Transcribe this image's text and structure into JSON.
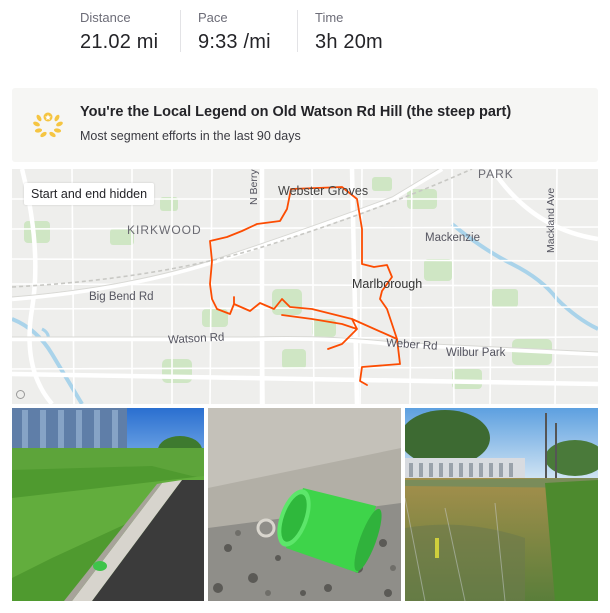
{
  "stats": [
    {
      "label": "Distance",
      "value": "21.02 mi"
    },
    {
      "label": "Pace",
      "value": "9:33 /mi"
    },
    {
      "label": "Time",
      "value": "3h 20m"
    }
  ],
  "legend": {
    "title": "You're the Local Legend on Old Watson Rd Hill (the steep part)",
    "subtitle": "Most segment efforts in the last 90 days",
    "icon": "laurel-icon",
    "accent": "#f5c542"
  },
  "map": {
    "badge": "Start and end hidden",
    "route_color": "#fc4c02",
    "places": {
      "webster_groves": "Webster Groves",
      "kirkwood": "KIRKWOOD",
      "mackenzie": "Mackenzie",
      "marlborough": "Marlborough",
      "big_bend": "Big Bend Rd",
      "watson": "Watson Rd",
      "weber": "Weber Rd",
      "wilbur_park": "Wilbur Park",
      "park": "PARK",
      "n_berry": "N Berry",
      "mackland": "Mackland Ave"
    }
  },
  "photos": [
    {
      "name": "photo-grass-walkway"
    },
    {
      "name": "photo-green-cup"
    },
    {
      "name": "photo-flooded-road"
    }
  ]
}
